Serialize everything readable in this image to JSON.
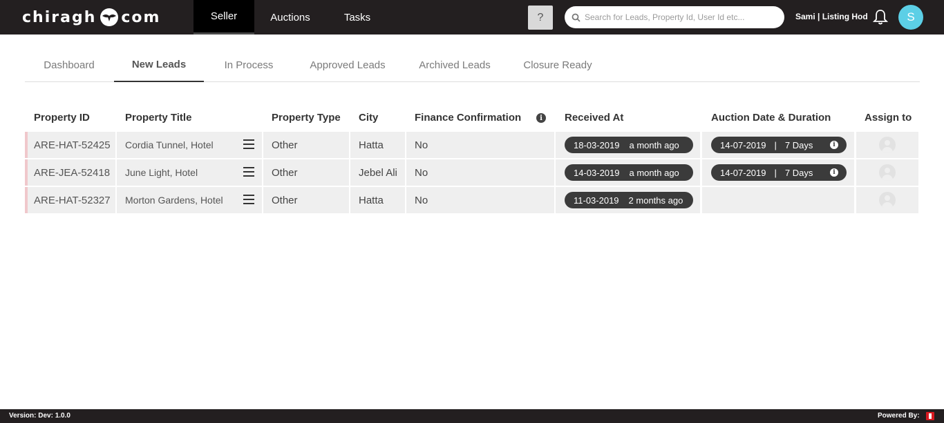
{
  "header": {
    "logo_left": "chiragh",
    "logo_right": "com",
    "nav": [
      "Seller",
      "Auctions",
      "Tasks"
    ],
    "active_nav": "Seller",
    "help_label": "?",
    "search_placeholder": "Search for Leads, Property Id, User Id etc...",
    "user_label": "Sami | Listing Hod",
    "avatar_initial": "S",
    "avatar_color": "#5ccfe6"
  },
  "subtabs": {
    "items": [
      "Dashboard",
      "New Leads",
      "In Process",
      "Approved Leads",
      "Archived Leads",
      "Closure Ready"
    ],
    "active": "New Leads"
  },
  "table": {
    "headers": {
      "property_id": "Property ID",
      "property_title": "Property Title",
      "property_type": "Property Type",
      "city": "City",
      "finance_confirmation": "Finance Confirmation",
      "received_at": "Received At",
      "auction_date_duration": "Auction Date & Duration",
      "assign_to": "Assign to"
    },
    "finance_info_icon": "i",
    "rows": [
      {
        "property_id": "ARE-HAT-52425",
        "property_title": "Cordia Tunnel, Hotel",
        "property_type": "Other",
        "city": "Hatta",
        "finance_confirmation": "No",
        "received_date": "18-03-2019",
        "received_ago": "a month ago",
        "auction_date": "14-07-2019",
        "auction_separator": "|",
        "auction_duration": "7 Days",
        "auction_info": "i"
      },
      {
        "property_id": "ARE-JEA-52418",
        "property_title": "June Light, Hotel",
        "property_type": "Other",
        "city": "Jebel Ali",
        "finance_confirmation": "No",
        "received_date": "14-03-2019",
        "received_ago": "a month ago",
        "auction_date": "14-07-2019",
        "auction_separator": "|",
        "auction_duration": "7 Days",
        "auction_info": "i"
      },
      {
        "property_id": "ARE-HAT-52327",
        "property_title": "Morton Gardens, Hotel",
        "property_type": "Other",
        "city": "Hatta",
        "finance_confirmation": "No",
        "received_date": "11-03-2019",
        "received_ago": "2 months ago",
        "auction_date": "",
        "auction_separator": "",
        "auction_duration": "",
        "auction_info": ""
      }
    ]
  },
  "footer": {
    "version": "Version: Dev: 1.0.0",
    "powered_by": "Powered By:"
  }
}
